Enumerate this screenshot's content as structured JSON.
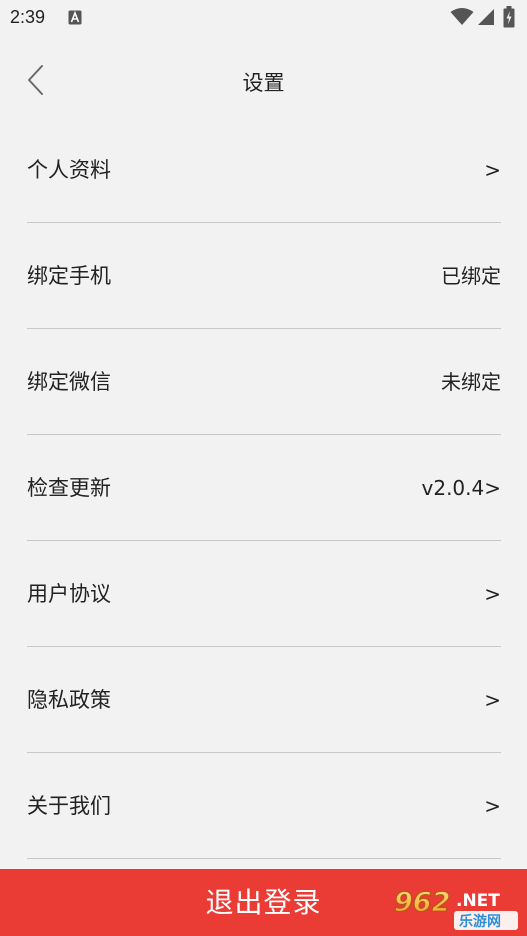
{
  "status_bar": {
    "time": "2:39"
  },
  "header": {
    "title": "设置"
  },
  "settings": [
    {
      "label": "个人资料",
      "value": ">"
    },
    {
      "label": "绑定手机",
      "value": "已绑定"
    },
    {
      "label": "绑定微信",
      "value": "未绑定"
    },
    {
      "label": "检查更新",
      "value": "v2.0.4>"
    },
    {
      "label": "用户协议",
      "value": ">"
    },
    {
      "label": "隐私政策",
      "value": ">"
    },
    {
      "label": "关于我们",
      "value": ">"
    }
  ],
  "logout": {
    "label": "退出登录"
  },
  "watermark": {
    "line1": "962.NET",
    "line2": "乐游网"
  },
  "colors": {
    "background": "#f2f2f2",
    "logout_button": "#ea3b34",
    "divider": "#c7c7c7"
  }
}
